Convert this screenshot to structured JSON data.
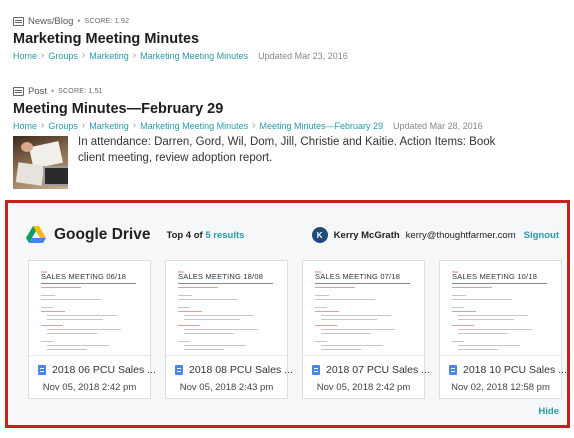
{
  "results": [
    {
      "type": "News/Blog",
      "score": "SCORE: 1.92",
      "title": "Marketing Meeting Minutes",
      "breadcrumbs": [
        "Home",
        "Groups",
        "Marketing",
        "Marketing Meeting Minutes"
      ],
      "updated": "Updated Mar 23, 2016"
    },
    {
      "type": "Post",
      "score": "SCORE: 1.51",
      "title": "Meeting Minutes—February 29",
      "breadcrumbs": [
        "Home",
        "Groups",
        "Marketing",
        "Marketing Meeting Minutes",
        "Meeting Minutes—February 29"
      ],
      "updated": "Updated Mar 28, 2016",
      "excerpt": "In attendance: Darren, Gord, Wil, Dom, Jill, Christie and Kaitie. Action Items: Book client meeting, review adoption report."
    }
  ],
  "google_drive": {
    "name": "Google Drive",
    "top_label": "Top 4 of",
    "results_link": "5 results",
    "user": {
      "initial": "K",
      "name": "Kerry McGrath",
      "email": "kerry@thoughtfarmer.com",
      "signout": "Signout"
    },
    "files": [
      {
        "preview_title": "SALES MEETING 06/18",
        "name": "2018 06 PCU Sales ...",
        "date": "Nov 05, 2018 2:42 pm"
      },
      {
        "preview_title": "SALES MEETING 18/08",
        "name": "2018 08 PCU Sales ...",
        "date": "Nov 05, 2018 2:43 pm"
      },
      {
        "preview_title": "SALES MEETING 07/18",
        "name": "2018 07 PCU Sales ...",
        "date": "Nov 05, 2018 2:42 pm"
      },
      {
        "preview_title": "SALES MEETING 10/18",
        "name": "2018 10 PCU Sales ...",
        "date": "Nov 02, 2018 12:58 pm"
      }
    ],
    "hide": "Hide",
    "border_color": "#c4221c"
  },
  "colors": {
    "link": "#2a9aa8"
  },
  "icons": {
    "result_type": "document-icon",
    "file": "google-doc-icon"
  }
}
